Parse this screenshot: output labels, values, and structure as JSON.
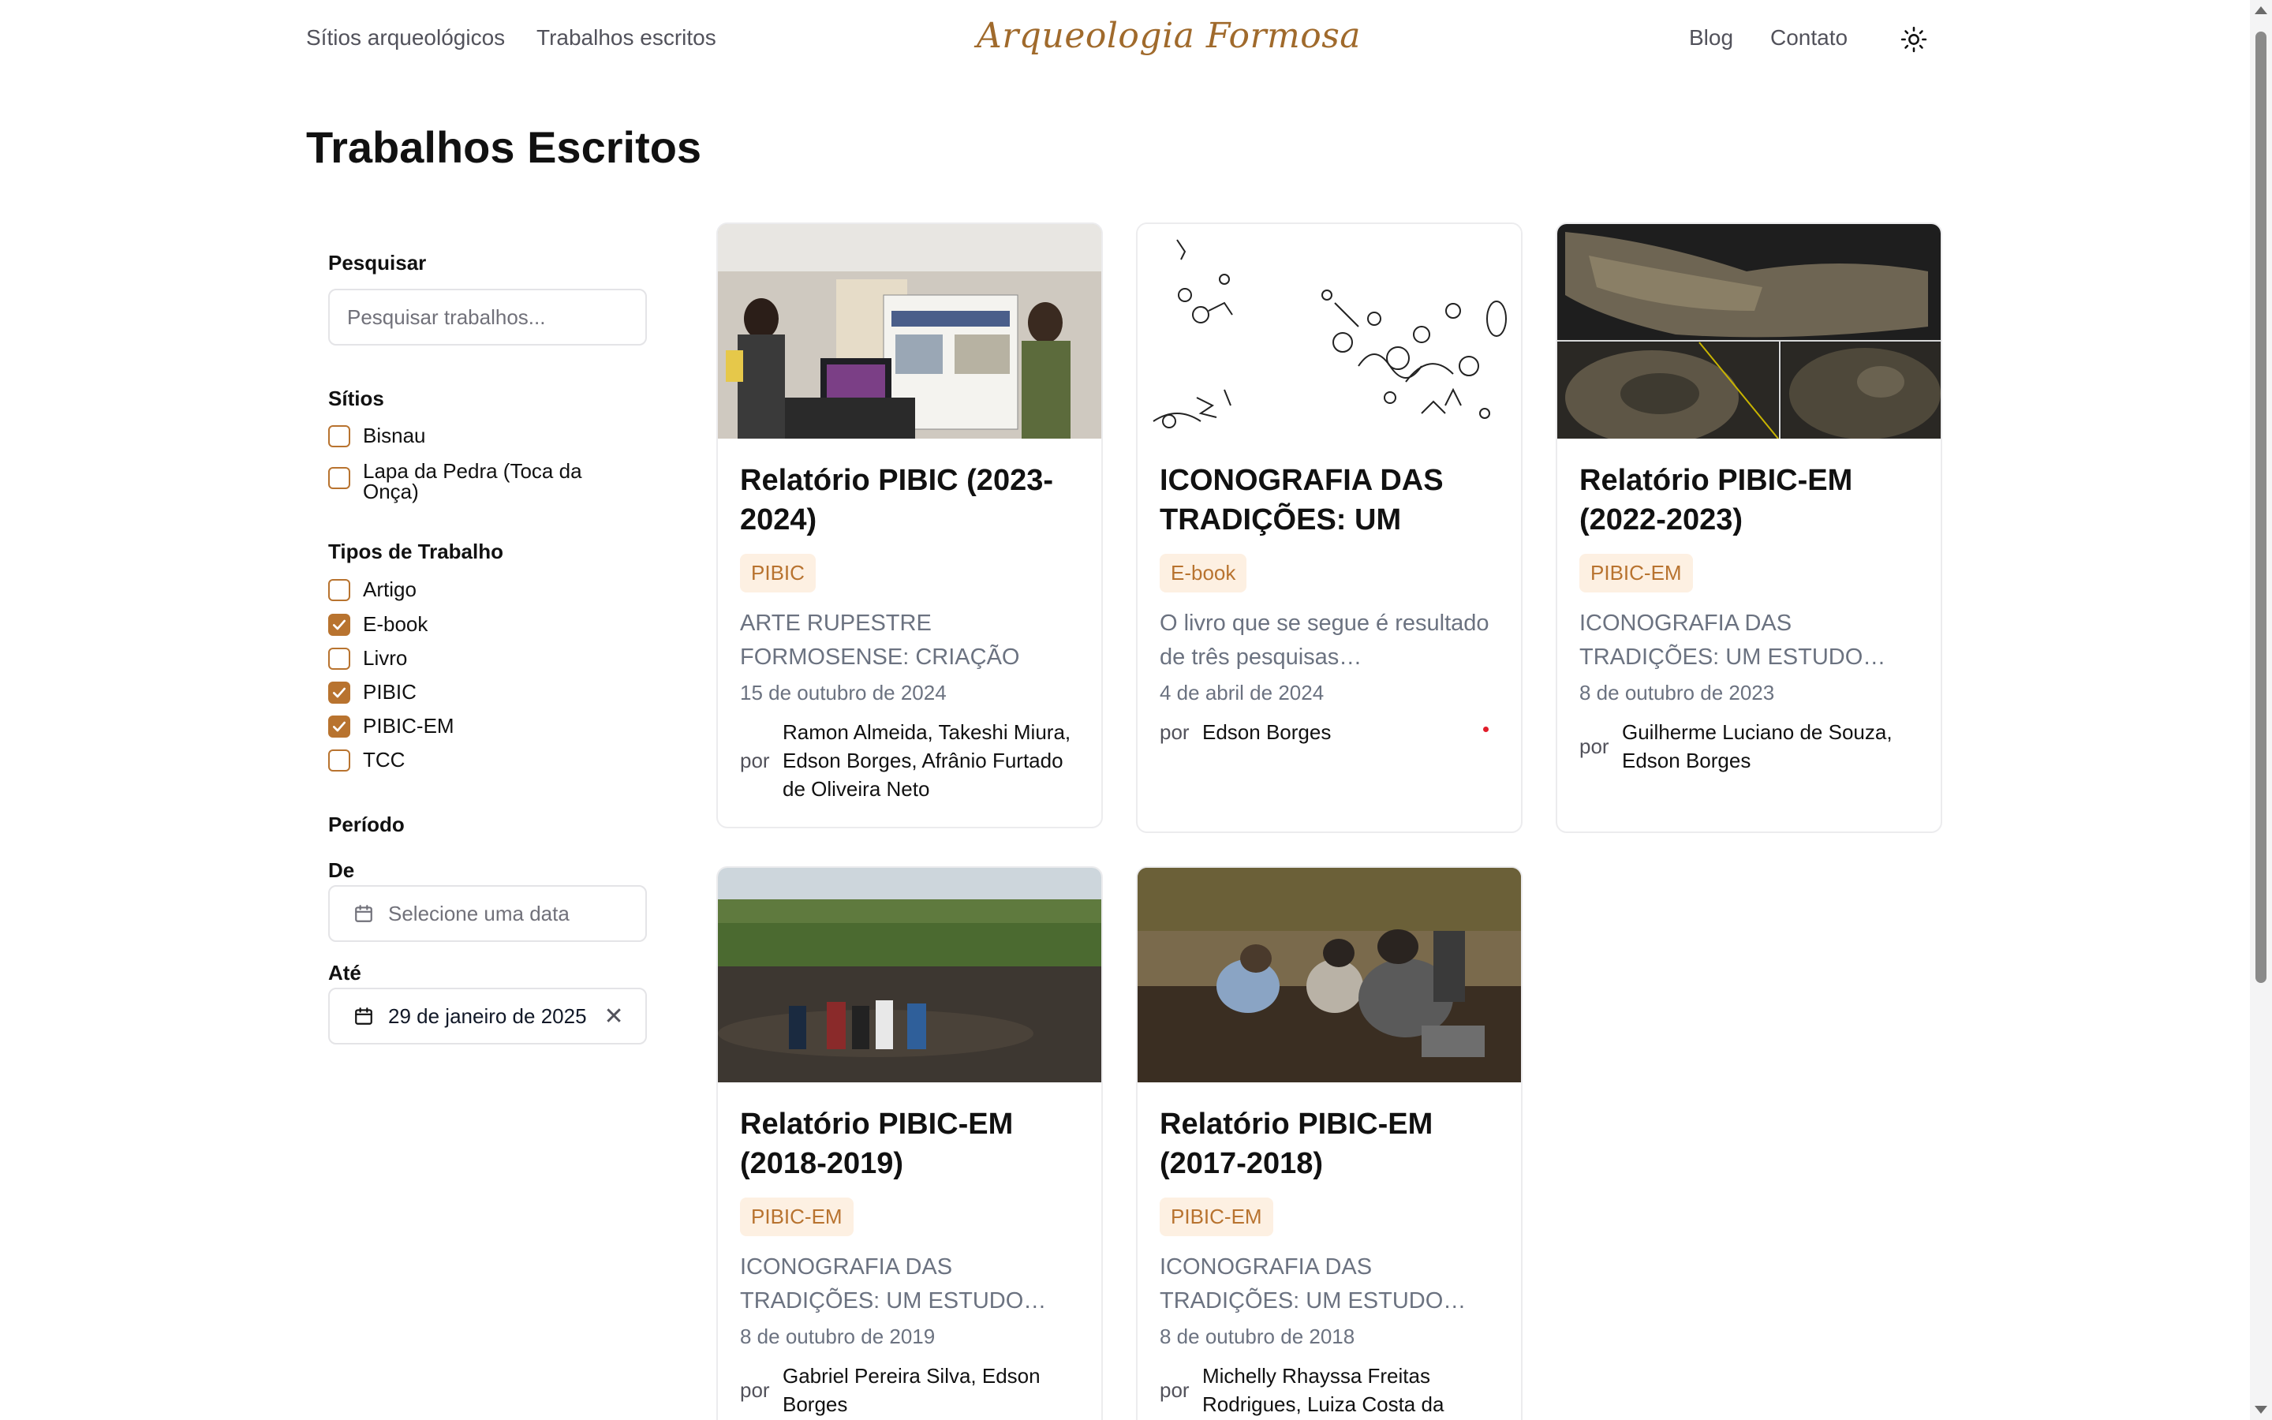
{
  "nav": {
    "left_links": [
      "Sítios arqueológicos",
      "Trabalhos escritos"
    ],
    "logo": "Arqueologia Formosa",
    "right_links": [
      "Blog",
      "Contato"
    ],
    "theme_icon": "sun-icon"
  },
  "page": {
    "title": "Trabalhos Escritos"
  },
  "sidebar": {
    "search": {
      "label": "Pesquisar",
      "placeholder": "Pesquisar trabalhos..."
    },
    "sites": {
      "label": "Sítios",
      "items": [
        {
          "label": "Bisnau",
          "checked": false
        },
        {
          "label": "Lapa da Pedra (Toca da Onça)",
          "checked": false
        }
      ]
    },
    "types": {
      "label": "Tipos de Trabalho",
      "items": [
        {
          "label": "Artigo",
          "checked": false
        },
        {
          "label": "E-book",
          "checked": true
        },
        {
          "label": "Livro",
          "checked": false
        },
        {
          "label": "PIBIC",
          "checked": true
        },
        {
          "label": "PIBIC-EM",
          "checked": true
        },
        {
          "label": "TCC",
          "checked": false
        }
      ]
    },
    "period": {
      "label": "Período",
      "from_label": "De",
      "from_placeholder": "Selecione uma data",
      "to_label": "Até",
      "to_value": "29 de janeiro de 2025"
    }
  },
  "cards": [
    {
      "title": "Relatório PIBIC (2023-2024)",
      "badge": "PIBIC",
      "excerpt": "ARTE RUPESTRE FORMOSENSE: CRIAÇÃO DE…",
      "date": "15 de outubro de 2024",
      "by": "por",
      "authors": "Ramon Almeida, Takeshi Miura, Edson Borges, Afrânio Furtado de Oliveira Neto"
    },
    {
      "title": "ICONOGRAFIA DAS TRADIÇÕES: UM OLH…",
      "badge": "E-book",
      "excerpt": "O livro que se segue é resultado de três pesquisas…",
      "date": "4 de abril de 2024",
      "by": "por",
      "authors": "Edson Borges"
    },
    {
      "title": "Relatório PIBIC-EM (2022-2023)",
      "badge": "PIBIC-EM",
      "excerpt": "ICONOGRAFIA DAS TRADIÇÕES: UM ESTUDO…",
      "date": "8 de outubro de 2023",
      "by": "por",
      "authors": "Guilherme Luciano de Souza, Edson Borges"
    },
    {
      "title": "Relatório PIBIC-EM (2018-2019)",
      "badge": "PIBIC-EM",
      "excerpt": "ICONOGRAFIA DAS TRADIÇÕES: UM ESTUDO…",
      "date": "8 de outubro de 2019",
      "by": "por",
      "authors": "Gabriel Pereira Silva, Edson Borges"
    },
    {
      "title": "Relatório PIBIC-EM (2017-2018)",
      "badge": "PIBIC-EM",
      "excerpt": "ICONOGRAFIA DAS TRADIÇÕES: UM ESTUDO…",
      "date": "8 de outubro de 2018",
      "by": "por",
      "authors": "Michelly Rhayssa Freitas Rodrigues, Luiza Costa da"
    }
  ],
  "colors": {
    "accent": "#b8732f",
    "badge_bg": "#fdf0e2"
  }
}
